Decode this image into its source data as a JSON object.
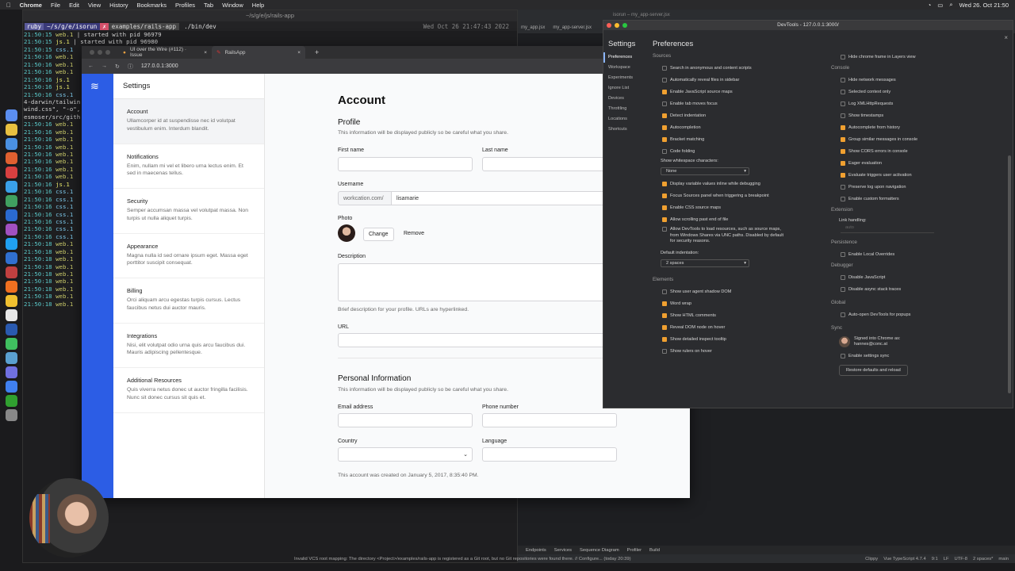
{
  "menubar": {
    "app": "Chrome",
    "items": [
      "File",
      "Edit",
      "View",
      "History",
      "Bookmarks",
      "Profiles",
      "Tab",
      "Window",
      "Help"
    ],
    "datetime": "Wed 26. Oct 21:50"
  },
  "terminal": {
    "title": "~/s/g/e/js/rails-app",
    "prompt_user": "ruby",
    "prompt_path": "~/s/g/e/isorun",
    "prompt_dir": "examples/rails-app",
    "prompt_cmd": "./bin/dev",
    "date": "Wed Oct 26 21:47:43 2022",
    "lines": [
      [
        "21:50:15",
        "web.1",
        " | started with pid 96979"
      ],
      [
        "21:50:15",
        "js.1",
        " | started with pid 96980"
      ],
      [
        "21:50:15",
        "css.1",
        ""
      ],
      [
        "21:50:16",
        "web.1",
        ""
      ],
      [
        "21:50:16",
        "web.1",
        ""
      ],
      [
        "21:50:16",
        "web.1",
        ""
      ],
      [
        "21:50:16",
        "js.1",
        ""
      ],
      [
        "21:50:16",
        "js.1",
        ""
      ],
      [
        "21:50:16",
        "css.1",
        ""
      ],
      [
        "4-darwin/tailwin",
        "",
        ""
      ],
      [
        "wind.css\", \"-o\",",
        "",
        ""
      ],
      [
        "esmoser/src/gith",
        "",
        ""
      ],
      [
        "21:50:16",
        "web.1",
        ""
      ],
      [
        "21:50:16",
        "web.1",
        ""
      ],
      [
        "21:50:16",
        "web.1",
        ""
      ],
      [
        "21:50:16",
        "web.1",
        ""
      ],
      [
        "21:50:16",
        "web.1",
        ""
      ],
      [
        "21:50:16",
        "web.1",
        ""
      ],
      [
        "21:50:16",
        "web.1",
        ""
      ],
      [
        "21:50:16",
        "web.1",
        ""
      ],
      [
        "21:50:16",
        "js.1",
        ""
      ],
      [
        "21:50:16",
        "css.1",
        ""
      ],
      [
        "21:50:16",
        "css.1",
        ""
      ],
      [
        "21:50:16",
        "css.1",
        ""
      ],
      [
        "21:50:16",
        "css.1",
        ""
      ],
      [
        "21:50:16",
        "css.1",
        ""
      ],
      [
        "21:50:16",
        "css.1",
        ""
      ],
      [
        "21:50:16",
        "css.1",
        ""
      ],
      [
        "21:50:18",
        "web.1",
        ""
      ],
      [
        "21:50:18",
        "web.1",
        ""
      ],
      [
        "21:50:18",
        "web.1",
        ""
      ],
      [
        "21:50:18",
        "web.1",
        ""
      ],
      [
        "21:50:18",
        "web.1",
        ""
      ],
      [
        "21:50:18",
        "web.1",
        ""
      ],
      [
        "21:50:18",
        "web.1",
        ""
      ],
      [
        "21:50:18",
        "web.1",
        ""
      ],
      [
        "21:50:18",
        "web.1",
        ""
      ]
    ]
  },
  "browser": {
    "tab1": "UI over the Wire (#112) · Issue",
    "tab2": "RailsApp",
    "url": "127.0.0.1:3000",
    "sidebar_title": "Settings",
    "nav": [
      {
        "title": "Account",
        "desc": "Ullamcorper id at suspendisse nec id volutpat vestibulum enim. Interdum blandit."
      },
      {
        "title": "Notifications",
        "desc": "Enim, nullam mi vel et libero urna lectus enim. Et sed in maecenas tellus."
      },
      {
        "title": "Security",
        "desc": "Semper accumsan massa vel volutpat massa. Non turpis ut nulla aliquet turpis."
      },
      {
        "title": "Appearance",
        "desc": "Magna nulla id sed ornare ipsum eget. Massa eget porttitor suscipit consequat."
      },
      {
        "title": "Billing",
        "desc": "Orci aliquam arcu egestas turpis cursus. Lectus faucibus netus dui auctor mauris."
      },
      {
        "title": "Integrations",
        "desc": "Nisi, elit volutpat odio urna quis arcu faucibus dui. Mauris adipiscing pellentesque."
      },
      {
        "title": "Additional Resources",
        "desc": "Quis viverra netus donec ut auctor fringilla facilisis. Nunc sit donec cursus sit quis et."
      }
    ],
    "account": {
      "heading": "Account",
      "profile": "Profile",
      "profile_sub": "This information will be displayed publicly so be careful what you share.",
      "first_name": "First name",
      "last_name": "Last name",
      "username": "Username",
      "username_prefix": "workcation.com/",
      "username_value": "lisamarie",
      "photo": "Photo",
      "change": "Change",
      "remove": "Remove",
      "description": "Description",
      "description_help": "Brief description for your profile. URLs are hyperlinked.",
      "url": "URL",
      "personal": "Personal Information",
      "personal_sub": "This information will be displayed publicly so be careful what you share.",
      "email": "Email address",
      "phone": "Phone number",
      "country": "Country",
      "language": "Language",
      "created": "This account was created on January 5, 2017, 8:35:40 PM."
    }
  },
  "ide": {
    "tabs": [
      "my_app.jsx",
      "my_app-server.jsx"
    ],
    "title": "isorun – my_app-server.jsx",
    "bottom": [
      "Endpoints",
      "Services",
      "Sequence Diagram",
      "Profiler",
      "Build"
    ],
    "status": "Invalid VCS root mapping: The directory <Project>/examples/rails-app is registered as a Git root, but no Git repositories were found there. // Configure... (today 20:39)",
    "status_right": [
      "Clippy",
      "Vue TypeScript 4.7.4",
      "9:1",
      "LF",
      "UTF-8",
      "2 spaces*",
      "main"
    ]
  },
  "devtools": {
    "title": "DevTools - 127.0.0.1:3000/",
    "settings": "Settings",
    "heading": "Preferences",
    "nav": [
      "Preferences",
      "Workspace",
      "Experiments",
      "Ignore List",
      "Devices",
      "Throttling",
      "Locations",
      "Shortcuts"
    ],
    "sources": "Sources",
    "left": [
      {
        "label": "Search in anonymous and content scripts",
        "on": false
      },
      {
        "label": "Automatically reveal files in sidebar",
        "on": false
      },
      {
        "label": "Enable JavaScript source maps",
        "on": true
      },
      {
        "label": "Enable tab moves focus",
        "on": false
      },
      {
        "label": "Detect indentation",
        "on": true
      },
      {
        "label": "Autocompletion",
        "on": true
      },
      {
        "label": "Bracket matching",
        "on": true
      },
      {
        "label": "Code folding",
        "on": false
      }
    ],
    "whitespace_label": "Show whitespace characters:",
    "whitespace_value": "None",
    "left2": [
      {
        "label": "Display variable values inline while debugging",
        "on": true
      },
      {
        "label": "Focus Sources panel when triggering a breakpoint",
        "on": true
      },
      {
        "label": "Enable CSS source maps",
        "on": true
      },
      {
        "label": "Allow scrolling past end of file",
        "on": true
      },
      {
        "label": "Allow DevTools to load resources, such as source maps, from Windows Shares via UNC paths. Disabled by default for security reasons.",
        "on": false
      }
    ],
    "indent_label": "Default indentation:",
    "indent_value": "2 spaces",
    "elements": "Elements",
    "elements_items": [
      {
        "label": "Show user agent shadow DOM",
        "on": false
      },
      {
        "label": "Word wrap",
        "on": true
      },
      {
        "label": "Show HTML comments",
        "on": true
      },
      {
        "label": "Reveal DOM node on hover",
        "on": true
      },
      {
        "label": "Show detailed inspect tooltip",
        "on": true
      },
      {
        "label": "Show rulers on hover",
        "on": false
      }
    ],
    "layers_item": {
      "label": "Hide chrome frame in Layers view",
      "on": false
    },
    "console": "Console",
    "console_items": [
      {
        "label": "Hide network messages",
        "on": false
      },
      {
        "label": "Selected context only",
        "on": false
      },
      {
        "label": "Log XMLHttpRequests",
        "on": false
      },
      {
        "label": "Show timestamps",
        "on": false
      },
      {
        "label": "Autocomplete from history",
        "on": true
      },
      {
        "label": "Group similar messages in console",
        "on": true
      },
      {
        "label": "Show CORS errors in console",
        "on": true
      },
      {
        "label": "Eager evaluation",
        "on": true
      },
      {
        "label": "Evaluate triggers user activation",
        "on": true
      },
      {
        "label": "Preserve log upon navigation",
        "on": false
      },
      {
        "label": "Enable custom formatters",
        "on": false
      }
    ],
    "extension": "Extension",
    "link_handling": "Link handling:",
    "link_value": "auto",
    "persistence": "Persistence",
    "persistence_item": {
      "label": "Enable Local Overrides",
      "on": false
    },
    "debugger": "Debugger",
    "debugger_items": [
      {
        "label": "Disable JavaScript",
        "on": false
      },
      {
        "label": "Disable async stack traces",
        "on": false
      }
    ],
    "global": "Global",
    "global_item": {
      "label": "Auto-open DevTools for popups",
      "on": false
    },
    "sync": "Sync",
    "signed_in": "Signed into Chrome as:",
    "signed_user": "hannes@conc.at",
    "sync_item": {
      "label": "Enable settings sync",
      "on": false
    },
    "restore": "Restore defaults and reload"
  }
}
